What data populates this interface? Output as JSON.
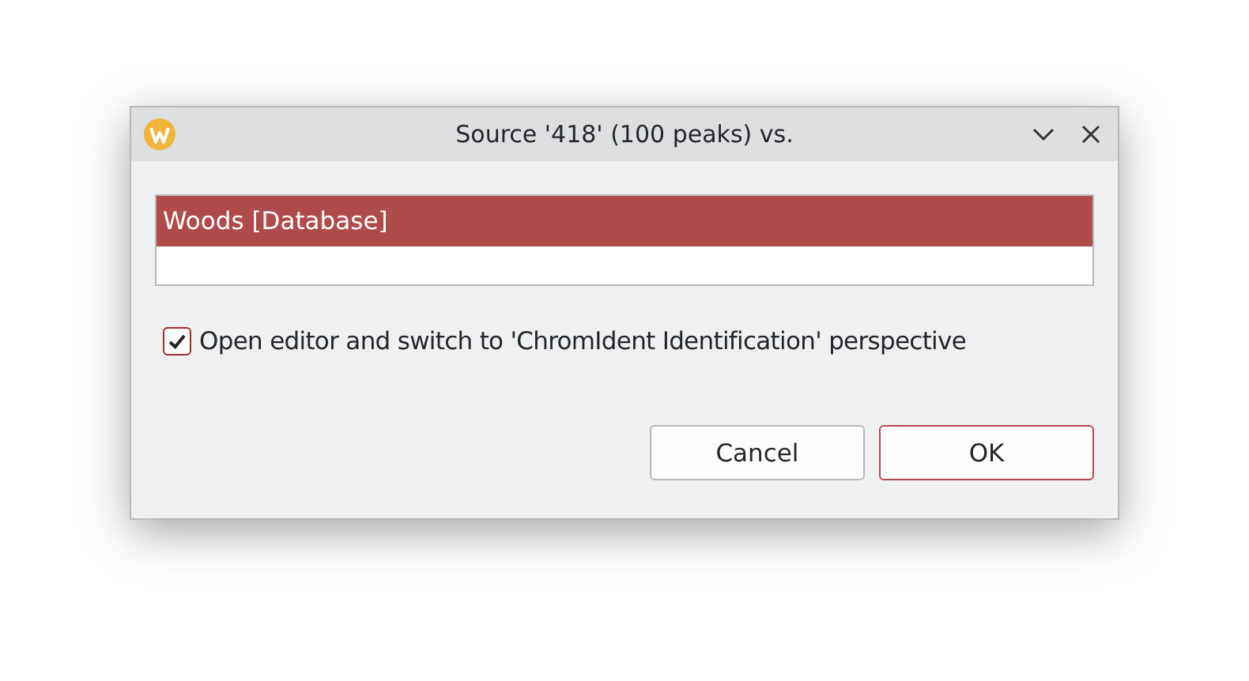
{
  "window": {
    "title": "Source '418' (100 peaks) vs."
  },
  "list": {
    "items": [
      {
        "label": "Woods [Database]",
        "selected": true
      }
    ]
  },
  "option": {
    "label": "Open editor and switch to 'ChromIdent Identification' perspective",
    "checked": true
  },
  "buttons": [
    {
      "label": "Cancel",
      "default": false
    },
    {
      "label": "OK",
      "default": true
    }
  ]
}
